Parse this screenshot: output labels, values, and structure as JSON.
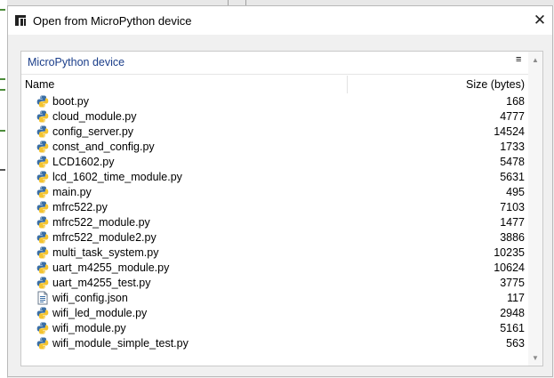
{
  "dialog": {
    "title": "Open from MicroPython device",
    "close_glyph": "✕"
  },
  "panel": {
    "title": "MicroPython device",
    "menu_glyph": "≡"
  },
  "columns": {
    "name": "Name",
    "size": "Size (bytes)"
  },
  "files": [
    {
      "name": "boot.py",
      "size": "168",
      "icon": "python-file-icon"
    },
    {
      "name": "cloud_module.py",
      "size": "4777",
      "icon": "python-file-icon"
    },
    {
      "name": "config_server.py",
      "size": "14524",
      "icon": "python-file-icon"
    },
    {
      "name": "const_and_config.py",
      "size": "1733",
      "icon": "python-file-icon"
    },
    {
      "name": "LCD1602.py",
      "size": "5478",
      "icon": "python-file-icon"
    },
    {
      "name": "lcd_1602_time_module.py",
      "size": "5631",
      "icon": "python-file-icon"
    },
    {
      "name": "main.py",
      "size": "495",
      "icon": "python-file-icon"
    },
    {
      "name": "mfrc522.py",
      "size": "7103",
      "icon": "python-file-icon"
    },
    {
      "name": "mfrc522_module.py",
      "size": "1477",
      "icon": "python-file-icon"
    },
    {
      "name": "mfrc522_module2.py",
      "size": "3886",
      "icon": "python-file-icon"
    },
    {
      "name": "multi_task_system.py",
      "size": "10235",
      "icon": "python-file-icon"
    },
    {
      "name": "uart_m4255_module.py",
      "size": "10624",
      "icon": "python-file-icon"
    },
    {
      "name": "uart_m4255_test.py",
      "size": "3775",
      "icon": "python-file-icon"
    },
    {
      "name": "wifi_config.json",
      "size": "117",
      "icon": "text-file-icon"
    },
    {
      "name": "wifi_led_module.py",
      "size": "2948",
      "icon": "python-file-icon"
    },
    {
      "name": "wifi_module.py",
      "size": "5161",
      "icon": "python-file-icon"
    },
    {
      "name": "wifi_module_simple_test.py",
      "size": "563",
      "icon": "python-file-icon"
    }
  ],
  "colors": {
    "panel_title": "#1b3e8a",
    "python_blue": "#3a6ea5",
    "python_yellow": "#f4c430"
  }
}
